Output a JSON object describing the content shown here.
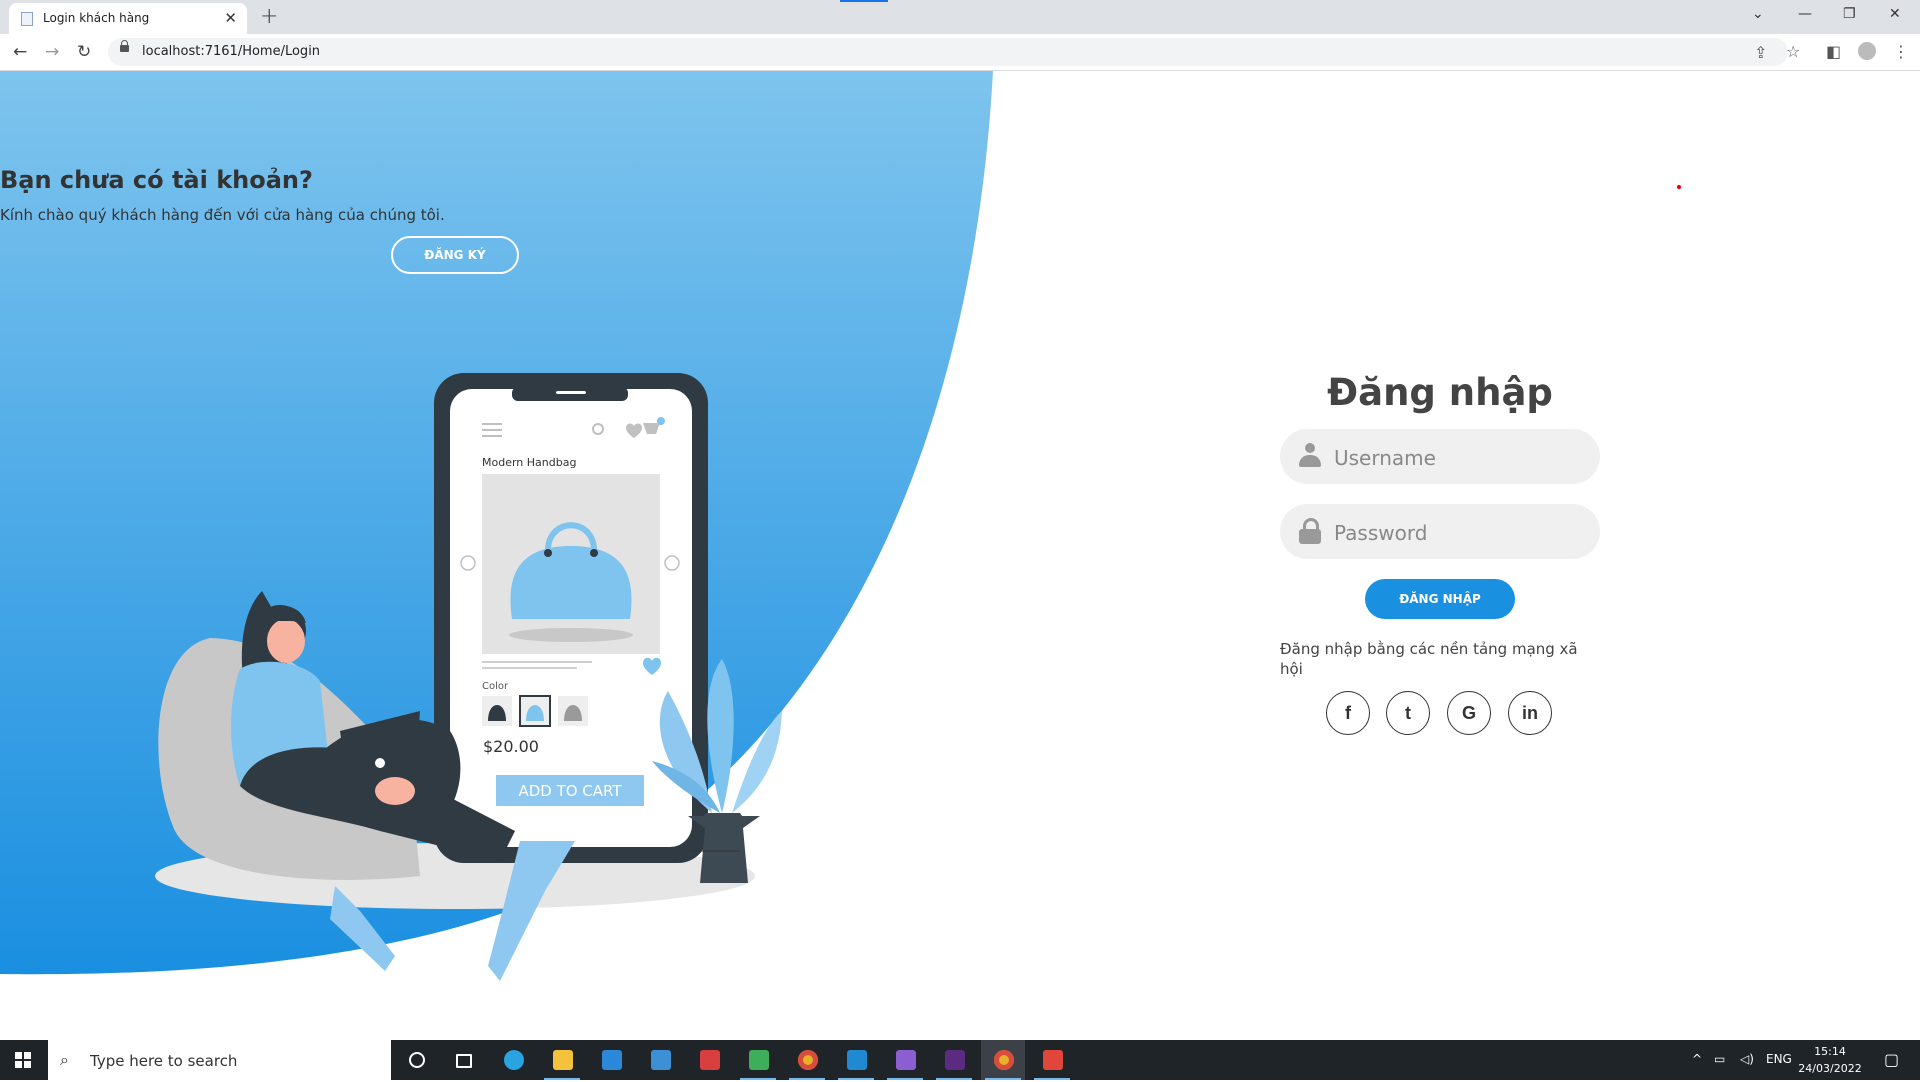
{
  "browser": {
    "tab_title": "Login khách hàng",
    "url": "localhost:7161/Home/Login"
  },
  "left_panel": {
    "title": "Bạn chưa có tài khoản?",
    "subtitle": "Kính chào quý khách hàng đến với cửa hàng của chúng tôi.",
    "register_button": "ĐĂNG KÝ"
  },
  "illustration": {
    "product_name": "Modern Handbag",
    "color_label": "Color",
    "price": "$20.00",
    "add_to_cart": "ADD TO CART",
    "cart_count": "1"
  },
  "login": {
    "title": "Đăng nhập",
    "username_placeholder": "Username",
    "password_placeholder": "Password",
    "submit_label": "ĐĂNG NHẬP",
    "social_text": "Đăng nhập bằng các nền tảng mạng xã hội",
    "social": [
      {
        "label": "f",
        "name": "facebook"
      },
      {
        "label": "t",
        "name": "twitter"
      },
      {
        "label": "G",
        "name": "google"
      },
      {
        "label": "in",
        "name": "linkedin"
      }
    ]
  },
  "colors": {
    "accent": "#1990e0",
    "blob_top": "#7ec4ee",
    "blob_bottom": "#1a8fe0",
    "taskbar": "#1f2429"
  },
  "taskbar": {
    "search_placeholder": "Type here to search",
    "language": "ENG",
    "time": "15:14",
    "date": "24/03/2022",
    "apps": [
      "cortana-icon",
      "task-view-icon",
      "edge-icon",
      "file-explorer-icon",
      "store-icon",
      "mail-icon",
      "app-icon",
      "snipping-icon",
      "chrome-icon",
      "vscode-icon",
      "visual-studio-icon",
      "terminal-icon",
      "chrome-icon",
      "git-icon"
    ]
  }
}
